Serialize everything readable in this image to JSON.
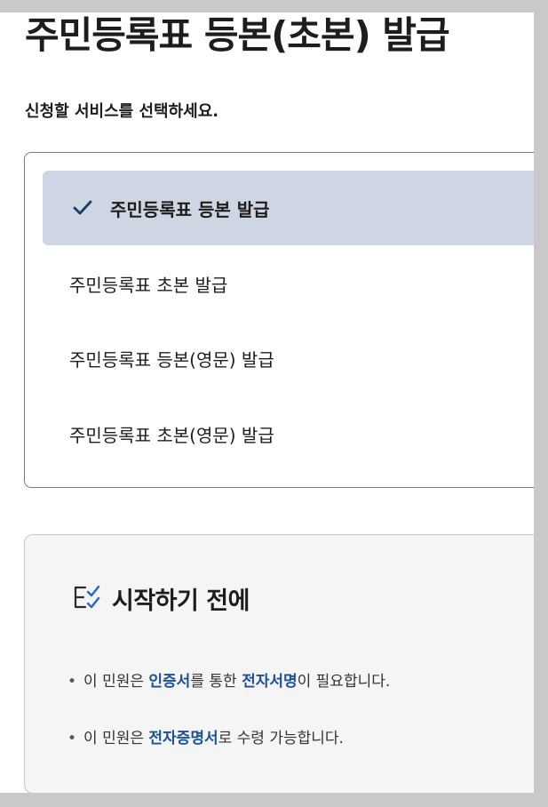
{
  "page": {
    "title": "주민등록표 등본(초본) 발급",
    "subtitle": "신청할 서비스를 선택하세요."
  },
  "options": [
    {
      "label": "주민등록표 등본 발급",
      "selected": true
    },
    {
      "label": "주민등록표 초본 발급",
      "selected": false
    },
    {
      "label": "주민등록표 등본(영문) 발급",
      "selected": false
    },
    {
      "label": "주민등록표 초본(영문) 발급",
      "selected": false
    }
  ],
  "info": {
    "icon": "checklist-icon",
    "title": "시작하기 전에",
    "bullet1": {
      "part1": "이 민원은 ",
      "em1": "인증서",
      "part2": "를 통한 ",
      "em2": "전자서명",
      "part3": "이 필요합니다."
    },
    "bullet2": {
      "part1": "이 민원은 ",
      "em1": "전자증명서",
      "part2": "로 수령 가능합니다."
    }
  },
  "colors": {
    "selected_bg": "#cdd6e2",
    "accent": "#1a4f9c",
    "check": "#1d3d6b",
    "page_bg": "#ffffff",
    "frame_bg": "#c9c9c9"
  }
}
